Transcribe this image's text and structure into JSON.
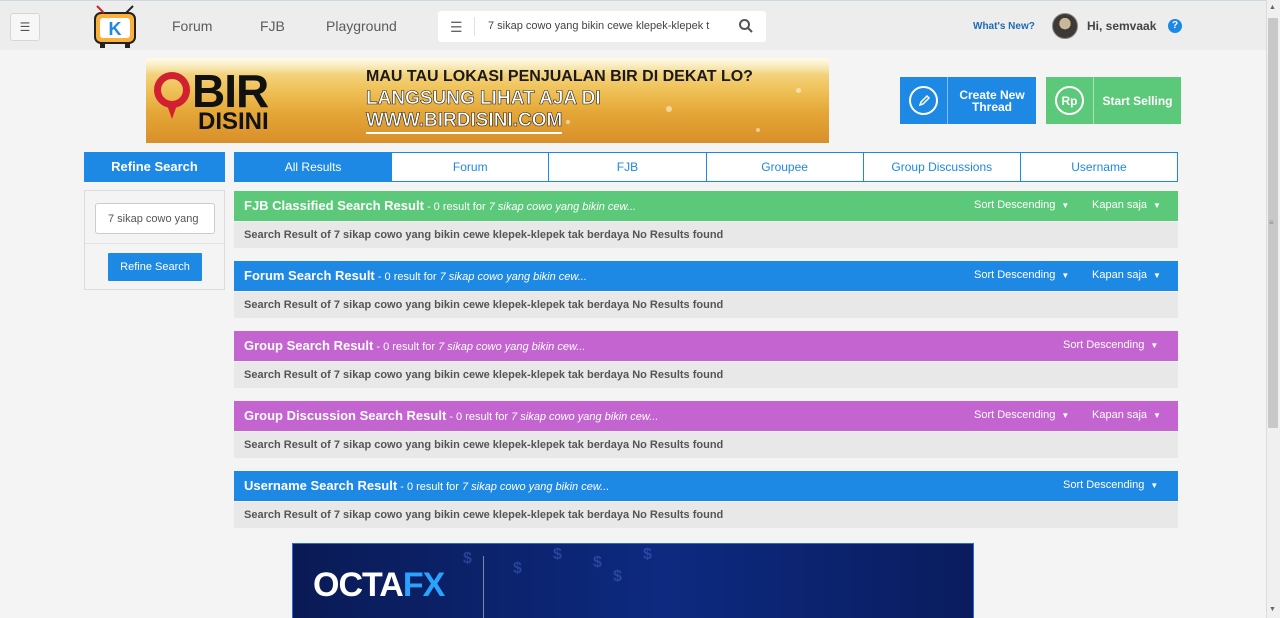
{
  "header": {
    "nav": [
      "Forum",
      "FJB",
      "Playground"
    ],
    "search_value": "7 sikap cowo yang bikin cewe klepek-klepek t",
    "whats_new": "What's New?",
    "greeting": "Hi, semvaak",
    "help": "?"
  },
  "banner": {
    "brand_top": "BIR",
    "brand_bottom": "DISINI",
    "line1": "MAU TAU LOKASI PENJUALAN BIR DI DEKAT LO?",
    "line2": "LANGSUNG LIHAT AJA DI",
    "line3": "WWW.BIRDISINI.COM"
  },
  "actions": {
    "create": "Create New Thread",
    "sell": "Start Selling",
    "sell_icon_text": "Rp"
  },
  "sidebar": {
    "title": "Refine Search",
    "input_value": "7 sikap cowo yang",
    "button": "Refine Search"
  },
  "tabs": [
    "All Results",
    "Forum",
    "FJB",
    "Groupee",
    "Group Discussions",
    "Username"
  ],
  "results": [
    {
      "title": "FJB Classified Search Result",
      "count": " - 0 result for ",
      "query": "7 sikap cowo yang bikin cew...",
      "sort": "Sort Descending",
      "time": "Kapan saja",
      "color": "#5cc97a",
      "body": "Search Result of 7 sikap cowo yang bikin cewe klepek-klepek tak berdaya No Results found"
    },
    {
      "title": "Forum Search Result",
      "count": " - 0 result for ",
      "query": "7 sikap cowo yang bikin cew...",
      "sort": "Sort Descending",
      "time": "Kapan saja",
      "color": "#1e88e5",
      "body": "Search Result of 7 sikap cowo yang bikin cewe klepek-klepek tak berdaya No Results found"
    },
    {
      "title": "Group Search Result",
      "count": " - 0 result for ",
      "query": "7 sikap cowo yang bikin cew...",
      "sort": "Sort Descending",
      "time": "",
      "color": "#c364d1",
      "body": "Search Result of 7 sikap cowo yang bikin cewe klepek-klepek tak berdaya No Results found"
    },
    {
      "title": "Group Discussion Search Result",
      "count": " - 0 result for ",
      "query": "7 sikap cowo yang bikin cew...",
      "sort": "Sort Descending",
      "time": "Kapan saja",
      "color": "#c364d1",
      "body": "Search Result of 7 sikap cowo yang bikin cewe klepek-klepek tak berdaya No Results found"
    },
    {
      "title": "Username Search Result",
      "count": " - 0 result for ",
      "query": "7 sikap cowo yang bikin cew...",
      "sort": "Sort Descending",
      "time": "",
      "color": "#1e88e5",
      "body": "Search Result of 7 sikap cowo yang bikin cewe klepek-klepek tak berdaya No Results found"
    }
  ],
  "ad": {
    "brand_a": "OCTA",
    "brand_b": "FX"
  },
  "colors": {
    "accent_blue": "#1e88e5",
    "green": "#5cc97a",
    "purple": "#c364d1"
  }
}
